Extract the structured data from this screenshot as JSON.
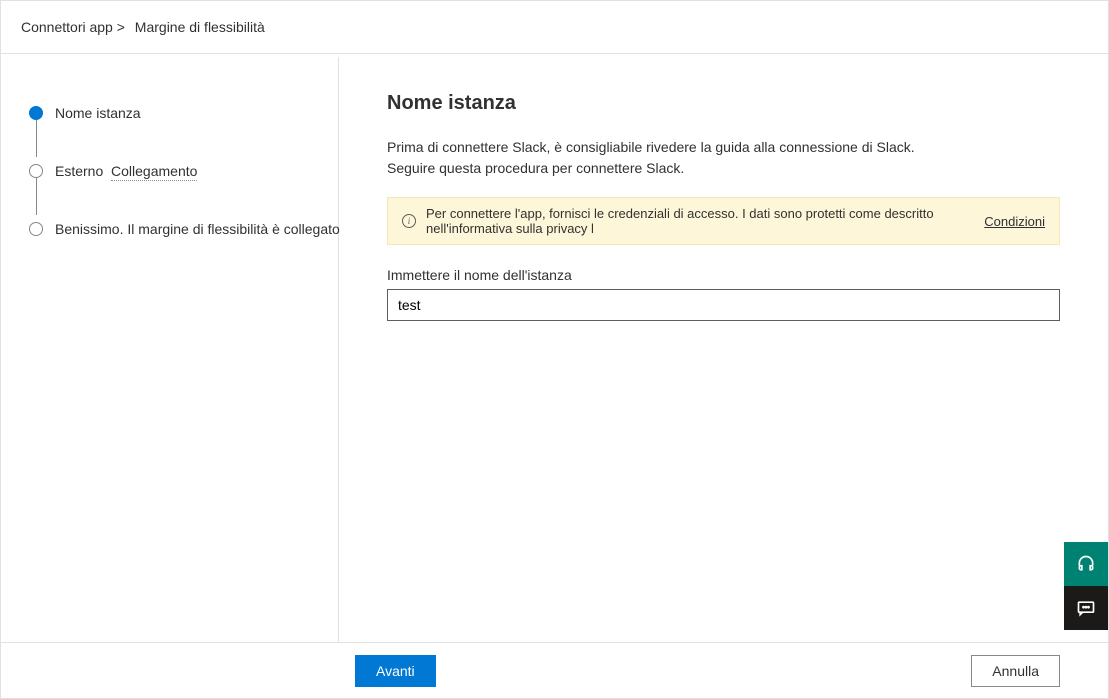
{
  "breadcrumb": {
    "root": "Connettori app >",
    "current": "Margine di flessibilità"
  },
  "sidebar": {
    "steps": [
      {
        "label": "Nome istanza",
        "active": true
      },
      {
        "label_prefix": "Esterno",
        "label_link": "Collegamento",
        "active": false,
        "has_link": true
      },
      {
        "label": "Benissimo. Il margine di flessibilità è collegato",
        "active": false
      }
    ]
  },
  "content": {
    "title": "Nome istanza",
    "description_line1": "Prima di connettere Slack, è consigliabile rivedere la guida alla connessione di Slack.",
    "description_line2": "Seguire questa procedura per connettere Slack.",
    "info_text": "Per connettere l'app, fornisci le credenziali di accesso. I dati sono protetti come descritto nell'informativa sulla privacy l",
    "info_link": "Condizioni",
    "field_label": "Immettere il nome dell'istanza",
    "field_value": "test"
  },
  "footer": {
    "next": "Avanti",
    "cancel": "Annulla"
  }
}
